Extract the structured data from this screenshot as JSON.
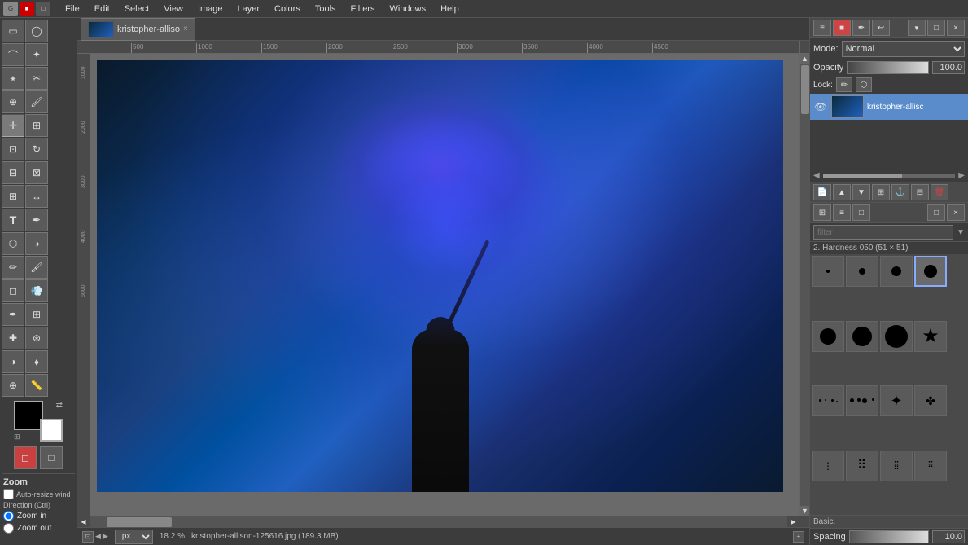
{
  "menubar": {
    "items": [
      "File",
      "Edit",
      "Select",
      "View",
      "Image",
      "Layer",
      "Colors",
      "Tools",
      "Filters",
      "Windows",
      "Help"
    ]
  },
  "tab": {
    "filename": "kristopher-alliso",
    "close_label": "×"
  },
  "layers": {
    "mode_label": "Mode:",
    "mode_value": "Normal",
    "opacity_label": "Opacity",
    "opacity_value": "100.0",
    "lock_label": "Lock:",
    "layer_name": "kristopher-allisc"
  },
  "brushes": {
    "filter_placeholder": "filter",
    "hardness_label": "2. Hardness 050 (51 × 51)",
    "category_label": "Basic.",
    "spacing_label": "Spacing",
    "spacing_value": "10.0"
  },
  "statusbar": {
    "unit": "px",
    "zoom": "18.2 %",
    "filename": "kristopher-allison-125616.jpg (189.3 MB)",
    "nav_left": "◀",
    "nav_right": "▶",
    "corner_icon": "+"
  },
  "zoom_panel": {
    "title": "Zoom",
    "auto_resize": "Auto-resize wind",
    "direction_label": "Direction  (Ctrl)",
    "zoom_in": "Zoom in",
    "zoom_out": "Zoom out"
  },
  "icons": {
    "eye": "👁",
    "pencil": "✏",
    "lock": "🔒",
    "lock_open": "🔓",
    "chain": "⛓",
    "paint": "🖌",
    "eraser": "◻",
    "clone": "⊞",
    "text": "T",
    "select_rect": "▭",
    "select_ellipse": "◯",
    "lasso": "⌒",
    "fuzzy": "✦",
    "scissors": "✂",
    "paths": "✒",
    "colorpick": "⬧",
    "magnify": "⊕",
    "move": "✛",
    "align": "⊞",
    "crop": "⊡",
    "perspective": "⊟",
    "flip": "↔",
    "bucket": "⬡",
    "smudge": "⊛",
    "dodge": "◑",
    "heal": "✚",
    "blend": "⬡",
    "ink": "✒",
    "measure": "📏",
    "new_guide": "⊞",
    "undo": "↩",
    "redo": "↪"
  },
  "colors": {
    "foreground": "#000000",
    "background": "#ffffff"
  },
  "ruler": {
    "ticks": [
      "500",
      "1000",
      "1500",
      "2000",
      "2500",
      "3000",
      "3500",
      "4000",
      "4500"
    ]
  }
}
